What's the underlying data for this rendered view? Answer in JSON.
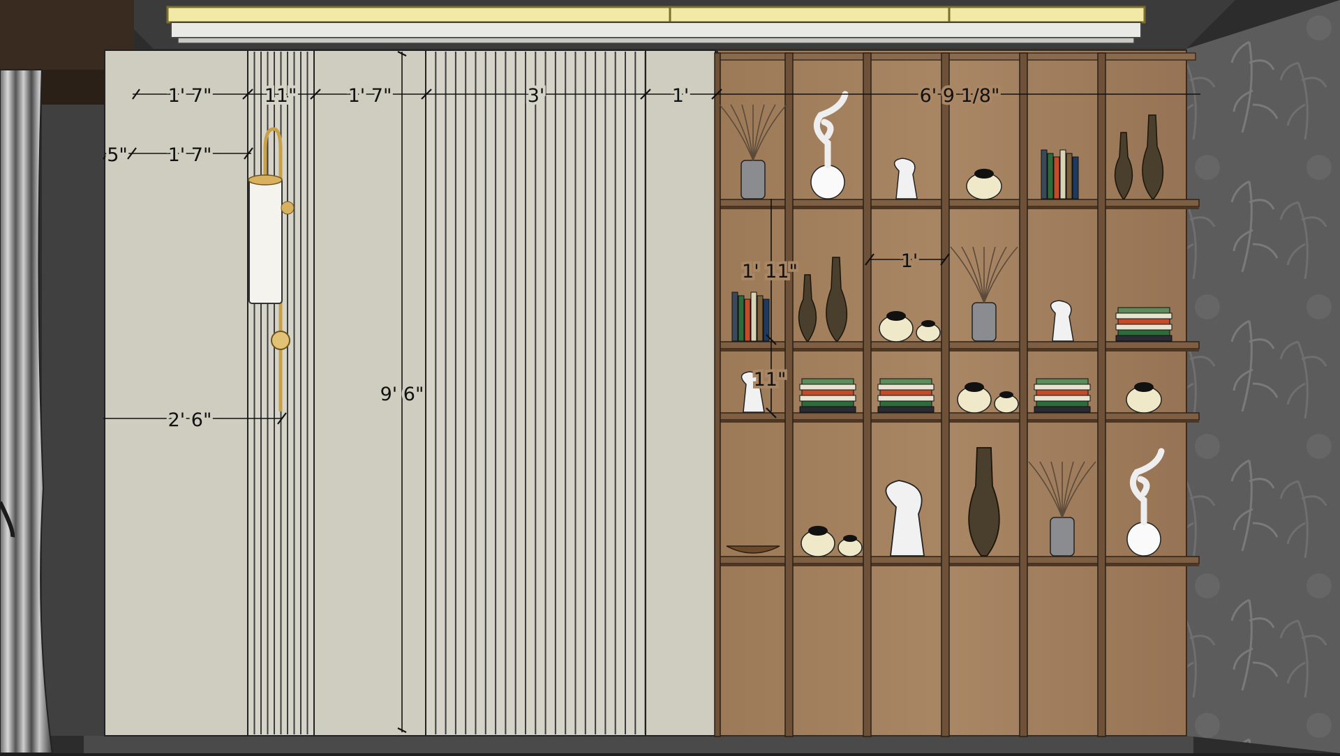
{
  "view": {
    "title": "",
    "palette": {
      "wall": "#cdcbbd",
      "slat_bg": "#d8d6cc",
      "slat_line": "#3c3c3c",
      "wood": "#a07e5c",
      "wood_dark": "#5a4330",
      "wallpaper": "#5f5f5f",
      "ceiling_light": "#f2e9a6",
      "brass": "#c9a04a"
    }
  },
  "dimensions": {
    "top_row": [
      {
        "id": "panel-1",
        "label": "1' 7\""
      },
      {
        "id": "fluted-1",
        "label": "11\""
      },
      {
        "id": "panel-2",
        "label": "1' 7\""
      },
      {
        "id": "fluted-2",
        "label": "3'"
      },
      {
        "id": "panel-3",
        "label": "1'"
      },
      {
        "id": "shelving",
        "label": "6' 9 1/8\""
      }
    ],
    "lamp_offset_left": {
      "label": "5\""
    },
    "lamp_offset_right": {
      "label": "1' 7\""
    },
    "lamp_height_from_side": {
      "label": "2' 6\""
    },
    "wall_height": {
      "label": "9' 6\""
    },
    "shelf_spacing_tall": {
      "label": "1' 11\""
    },
    "shelf_spacing_short": {
      "label": "11\""
    },
    "cubby_width": {
      "label": "1'"
    }
  },
  "shelving": {
    "columns": 6,
    "shelf_rows": 4
  },
  "decor": {
    "items": [
      {
        "type": "branch-vase",
        "col": 0,
        "row": 0
      },
      {
        "type": "figurine",
        "col": 1,
        "row": 0
      },
      {
        "type": "bust",
        "col": 2,
        "row": 0
      },
      {
        "type": "pot",
        "col": 3,
        "row": 0
      },
      {
        "type": "books",
        "col": 4,
        "row": 0
      },
      {
        "type": "bottle-pair",
        "col": 5,
        "row": 0
      },
      {
        "type": "books",
        "col": 0,
        "row": 1
      },
      {
        "type": "bottle-pair",
        "col": 1,
        "row": 1
      },
      {
        "type": "pot-pair",
        "col": 2,
        "row": 1
      },
      {
        "type": "branch-vase",
        "col": 3,
        "row": 1
      },
      {
        "type": "bust",
        "col": 4,
        "row": 1
      },
      {
        "type": "book-stack",
        "col": 5,
        "row": 1
      },
      {
        "type": "bust",
        "col": 0,
        "row": 2
      },
      {
        "type": "book-stack",
        "col": 1,
        "row": 2
      },
      {
        "type": "book-stack",
        "col": 2,
        "row": 2
      },
      {
        "type": "pot-pair",
        "col": 3,
        "row": 2
      },
      {
        "type": "book-stack",
        "col": 4,
        "row": 2
      },
      {
        "type": "pot",
        "col": 5,
        "row": 2
      },
      {
        "type": "bowl",
        "col": 0,
        "row": 3
      },
      {
        "type": "pot-pair",
        "col": 1,
        "row": 3
      },
      {
        "type": "big-bust",
        "col": 2,
        "row": 3
      },
      {
        "type": "big-bottle",
        "col": 3,
        "row": 3
      },
      {
        "type": "branch-vase",
        "col": 4,
        "row": 3
      },
      {
        "type": "figurine",
        "col": 5,
        "row": 3
      }
    ]
  }
}
